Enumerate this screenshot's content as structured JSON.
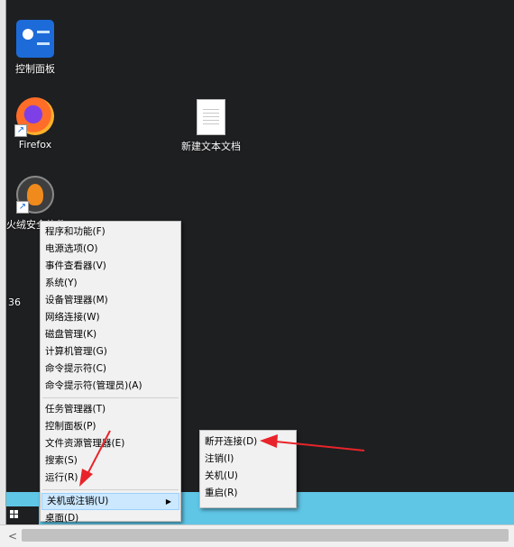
{
  "desktop": {
    "icons": [
      {
        "name": "control-panel",
        "label": "控制面板"
      },
      {
        "name": "firefox",
        "label": "Firefox"
      },
      {
        "name": "huorong",
        "label": "火绒安全软件"
      },
      {
        "name": "partial-36",
        "label": "36"
      },
      {
        "name": "new-text-doc",
        "label": "新建文本文档"
      }
    ]
  },
  "context_menu": {
    "items": [
      {
        "label": "程序和功能(F)"
      },
      {
        "label": "电源选项(O)"
      },
      {
        "label": "事件查看器(V)"
      },
      {
        "label": "系统(Y)"
      },
      {
        "label": "设备管理器(M)"
      },
      {
        "label": "网络连接(W)"
      },
      {
        "label": "磁盘管理(K)"
      },
      {
        "label": "计算机管理(G)"
      },
      {
        "label": "命令提示符(C)"
      },
      {
        "label": "命令提示符(管理员)(A)"
      },
      {
        "label": "任务管理器(T)"
      },
      {
        "label": "控制面板(P)"
      },
      {
        "label": "文件资源管理器(E)"
      },
      {
        "label": "搜索(S)"
      },
      {
        "label": "运行(R)"
      },
      {
        "label": "关机或注销(U)"
      },
      {
        "label": "桌面(D)"
      }
    ]
  },
  "submenu": {
    "items": [
      {
        "label": "断开连接(D)"
      },
      {
        "label": "注销(I)"
      },
      {
        "label": "关机(U)"
      },
      {
        "label": "重启(R)"
      }
    ]
  },
  "colors": {
    "desktop_bg": "#1e1f21",
    "menu_bg": "#f1f1f1",
    "selected_bg": "#cce8ff",
    "taskbar": "#5fc6e6",
    "arrow_red": "#e8242a"
  },
  "icons": [
    "control-panel-icon",
    "firefox-icon",
    "huorong-icon",
    "text-document-icon",
    "windows-logo-icon",
    "chevron-right-icon",
    "scroll-left-icon"
  ]
}
